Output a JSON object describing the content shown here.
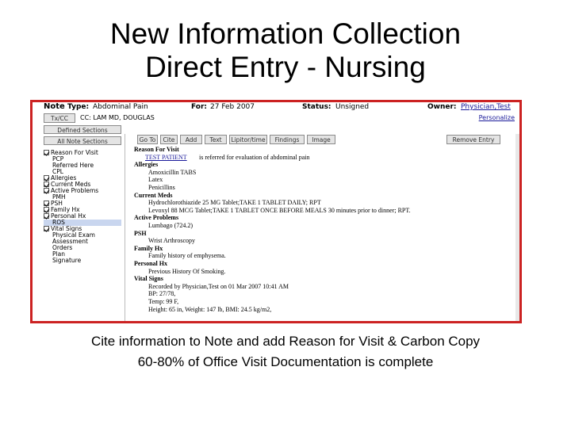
{
  "slide": {
    "title_line1": "New Information Collection",
    "title_line2": "Direct Entry - Nursing",
    "caption_line1": "Cite information to Note and add Reason for Visit & Carbon Copy",
    "caption_line2": "60-80% of Office Visit Documentation is complete"
  },
  "header": {
    "note_label": "Note",
    "type_label": "Type:",
    "type_value": "Abdominal Pain",
    "for_label": "For:",
    "for_value": "27 Feb 2007",
    "status_label": "Status:",
    "status_value": "Unsigned",
    "owner_label": "Owner:",
    "owner_value": "Physician,Test"
  },
  "cc": {
    "button_label": "Tx/CC",
    "text": "CC: LAM MD, DOUGLAS",
    "personalize": "Personalize"
  },
  "leftpane": {
    "defined_sections": "Defined Sections",
    "all_note_sections": "All Note Sections",
    "items": [
      {
        "label": "Reason For Visit",
        "checked": true,
        "selected": false
      },
      {
        "label": "PCP",
        "checked": false,
        "selected": false
      },
      {
        "label": "Referred Here",
        "checked": false,
        "selected": false
      },
      {
        "label": "CPL",
        "checked": false,
        "selected": false
      },
      {
        "label": "Allergies",
        "checked": true,
        "selected": false
      },
      {
        "label": "Current Meds",
        "checked": true,
        "selected": false
      },
      {
        "label": "Active Problems",
        "checked": true,
        "selected": false
      },
      {
        "label": "PMH",
        "checked": false,
        "selected": false
      },
      {
        "label": "PSH",
        "checked": true,
        "selected": false
      },
      {
        "label": "Family Hx",
        "checked": true,
        "selected": false
      },
      {
        "label": "Personal Hx",
        "checked": true,
        "selected": false
      },
      {
        "label": "ROS",
        "checked": false,
        "selected": true
      },
      {
        "label": "Vital Signs",
        "checked": true,
        "selected": false
      },
      {
        "label": "Physical Exam",
        "checked": false,
        "selected": false
      },
      {
        "label": "Assessment",
        "checked": false,
        "selected": false
      },
      {
        "label": "Orders",
        "checked": false,
        "selected": false
      },
      {
        "label": "Plan",
        "checked": false,
        "selected": false
      },
      {
        "label": "Signature",
        "checked": false,
        "selected": false
      }
    ]
  },
  "toolbar": {
    "buttons": [
      "Go To",
      "Cite",
      "Add",
      "Text",
      "Lipitor/time",
      "Findings",
      "Image"
    ],
    "remove_entry": "Remove Entry"
  },
  "note": {
    "lines": [
      {
        "text": "Reason For Visit",
        "kind": "h",
        "indent": 0
      },
      {
        "text": "TEST PATIENT ",
        "kind": "link",
        "indent": 14
      },
      {
        "text": "is referred for evaluation of abdominal pain",
        "kind": "t",
        "indent": 82
      },
      {
        "text": "Allergies",
        "kind": "h",
        "indent": 0
      },
      {
        "text": "Amoxicillin TABS",
        "kind": "t",
        "indent": 18
      },
      {
        "text": "Latex",
        "kind": "t",
        "indent": 18
      },
      {
        "text": "Penicillins",
        "kind": "t",
        "indent": 18
      },
      {
        "text": "Current Meds",
        "kind": "h",
        "indent": 0
      },
      {
        "text": "Hydrochlorothiazide 25 MG Tablet;TAKE 1 TABLET DAILY; RPT",
        "kind": "t",
        "indent": 18
      },
      {
        "text": "Levoxyl 88 MCG Tablet;TAKE 1 TABLET ONCE BEFORE MEALS 30 minutes prior to dinner; RPT.",
        "kind": "t",
        "indent": 18
      },
      {
        "text": "Active Problems",
        "kind": "h",
        "indent": 0
      },
      {
        "text": "Lumbago (724.2)",
        "kind": "t",
        "indent": 18
      },
      {
        "text": "PSH",
        "kind": "h",
        "indent": 0
      },
      {
        "text": "Wrist Arthroscopy",
        "kind": "t",
        "indent": 18
      },
      {
        "text": "Family Hx",
        "kind": "h",
        "indent": 0
      },
      {
        "text": "Family history of emphysema.",
        "kind": "t",
        "indent": 18
      },
      {
        "text": "Personal Hx",
        "kind": "h",
        "indent": 0
      },
      {
        "text": "Previous History Of Smoking.",
        "kind": "t",
        "indent": 18
      },
      {
        "text": "Vital Signs",
        "kind": "h",
        "indent": 0
      },
      {
        "text": "Recorded by Physician,Test on 01 Mar 2007 10:41 AM",
        "kind": "t",
        "indent": 18
      },
      {
        "text": "BP: 27/78,",
        "kind": "t",
        "indent": 18
      },
      {
        "text": "Temp: 99 F,",
        "kind": "t",
        "indent": 18
      },
      {
        "text": "Height: 65 in, Weight: 147 lb, BMI: 24.5 kg/m2,",
        "kind": "t",
        "indent": 18
      }
    ]
  }
}
